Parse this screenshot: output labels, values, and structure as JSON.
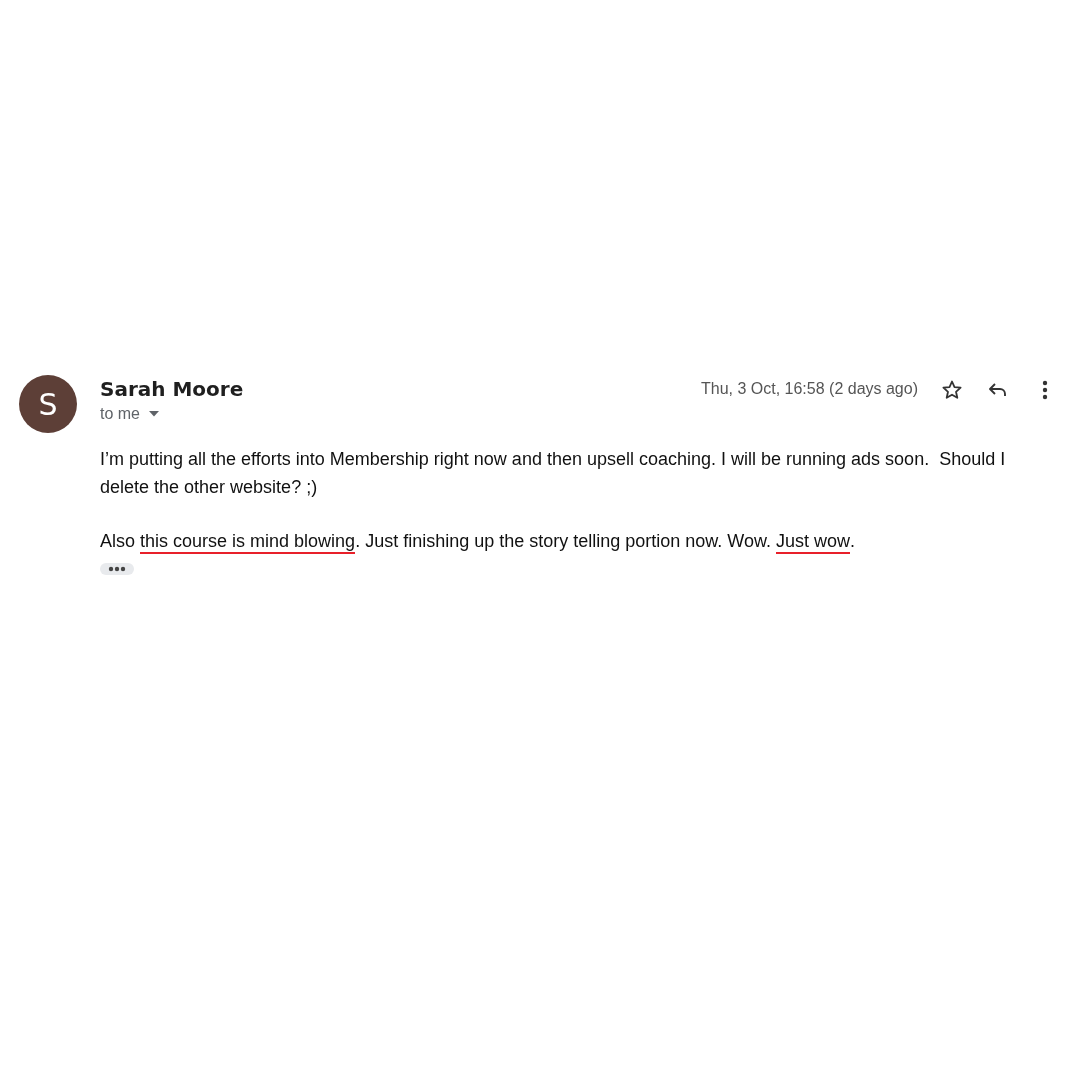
{
  "message": {
    "sender": "Sarah Moore",
    "avatar_letter": "S",
    "recipient": "to me",
    "date": "Thu, 3 Oct, 16:58 (2 days ago)",
    "paragraphs": [
      [
        {
          "text": "I’m putting all the efforts into Membership right now and then upsell coaching. I will be running ads soon.  Should I delete the other website? ;)",
          "underlined": false
        }
      ],
      [
        {
          "text": "Also ",
          "underlined": false
        },
        {
          "text": "this course is mind blowing",
          "underlined": true
        },
        {
          "text": ". Just finishing up the story telling portion now. Wow. ",
          "underlined": false
        },
        {
          "text": "Just wow",
          "underlined": true
        },
        {
          "text": ".",
          "underlined": false
        }
      ]
    ]
  }
}
